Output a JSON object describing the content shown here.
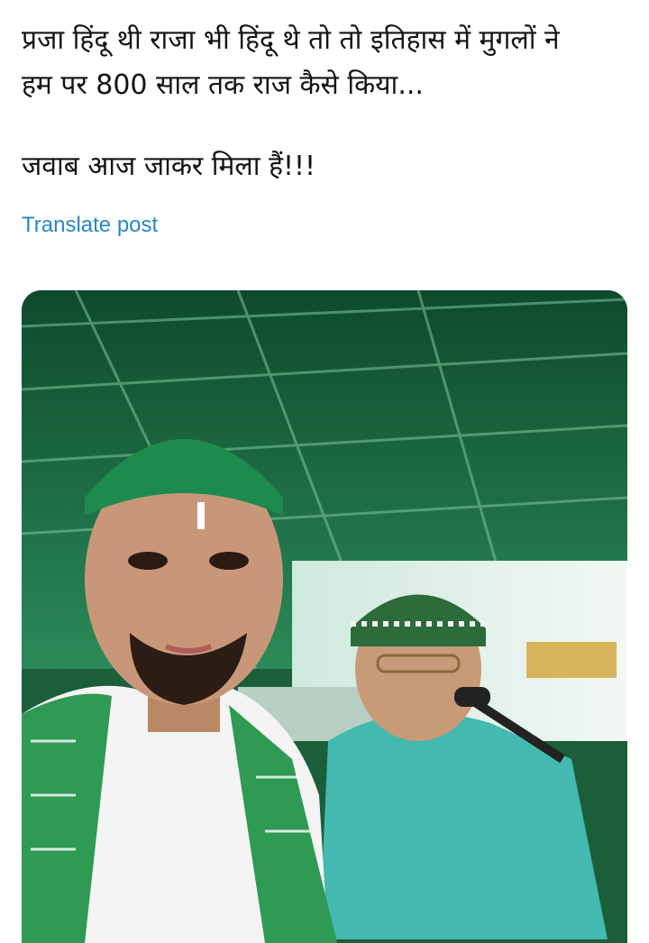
{
  "post": {
    "line1": "प्रजा हिंदू थी राजा भी हिंदू थे तो तो इतिहास में मुगलों ने",
    "line2": "हम पर 800 साल तक राज कैसे किया...",
    "line3": "जवाब आज जाकर मिला हैं!!!",
    "translate_label": "Translate post"
  },
  "photo": {
    "accent_green": "#1f7a4a",
    "cap_green": "#1d8a4e",
    "kurta_teal": "#43b9b0"
  }
}
